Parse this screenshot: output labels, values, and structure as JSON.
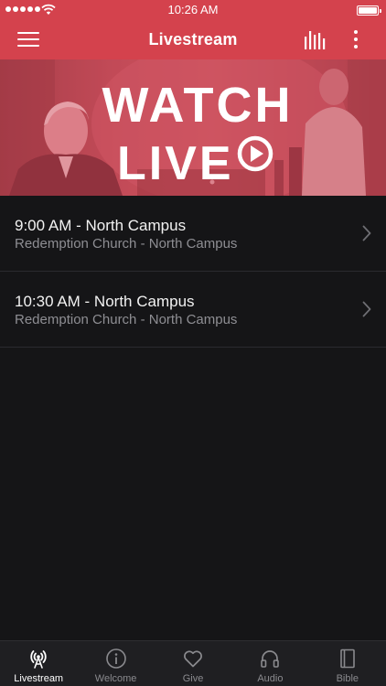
{
  "status_bar": {
    "time": "10:26 AM"
  },
  "nav": {
    "title": "Livestream",
    "left_icon": "hamburger-menu-icon",
    "right_icons": [
      "audio-bars-icon",
      "more-vertical-icon"
    ]
  },
  "banner": {
    "line1": "WATCH",
    "line2": "LIVE",
    "icon": "play-circle-icon"
  },
  "streams": [
    {
      "title": "9:00 AM - North Campus",
      "subtitle": "Redemption Church - North Campus"
    },
    {
      "title": "10:30 AM - North Campus",
      "subtitle": "Redemption Church - North Campus"
    }
  ],
  "tabs": [
    {
      "label": "Livestream",
      "icon": "broadcast-icon",
      "active": true
    },
    {
      "label": "Welcome",
      "icon": "info-icon",
      "active": false
    },
    {
      "label": "Give",
      "icon": "heart-icon",
      "active": false
    },
    {
      "label": "Audio",
      "icon": "headphones-icon",
      "active": false
    },
    {
      "label": "Bible",
      "icon": "book-icon",
      "active": false
    }
  ],
  "colors": {
    "accent": "#d4424d",
    "background": "#151517",
    "tabbar": "#1f1f22",
    "text_secondary": "#8e8e93"
  }
}
